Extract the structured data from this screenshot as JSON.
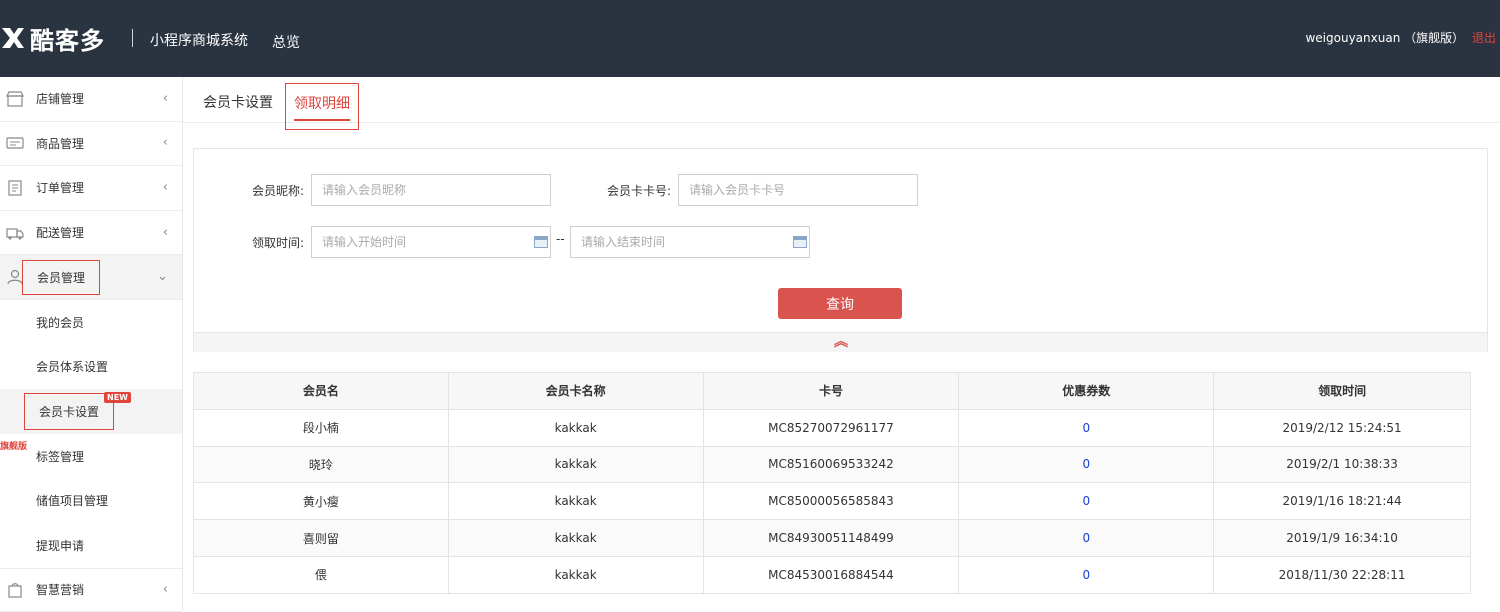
{
  "header": {
    "brand": "酷客多",
    "system_name": "小程序商城系统",
    "nav_overview": "总览",
    "username": "weigouyanxuan",
    "edition": "（旗舰版）",
    "logout": "退出"
  },
  "sidebar": {
    "items": [
      {
        "label": "店铺管理",
        "icon": "store-icon"
      },
      {
        "label": "商品管理",
        "icon": "goods-icon"
      },
      {
        "label": "订单管理",
        "icon": "order-icon"
      },
      {
        "label": "配送管理",
        "icon": "delivery-icon"
      },
      {
        "label": "会员管理",
        "icon": "member-icon"
      }
    ],
    "sub_items": [
      {
        "label": "我的会员"
      },
      {
        "label": "会员体系设置"
      },
      {
        "label": "会员卡设置"
      },
      {
        "label": "标签管理"
      },
      {
        "label": "储值项目管理"
      },
      {
        "label": "提现申请"
      }
    ],
    "bottom_item": {
      "label": "智慧营销",
      "icon": "marketing-icon"
    },
    "badge_new": "NEW",
    "badge_flag": "旗舰版"
  },
  "tabs": [
    {
      "label": "会员卡设置"
    },
    {
      "label": "领取明细",
      "active": true
    }
  ],
  "filter": {
    "nickname_label": "会员昵称:",
    "nickname_placeholder": "请输入会员昵称",
    "card_no_label": "会员卡卡号:",
    "card_no_placeholder": "请输入会员卡卡号",
    "time_label": "领取时间:",
    "start_placeholder": "请输入开始时间",
    "end_placeholder": "请输入结束时间",
    "range_sep": "--",
    "query_button": "查询",
    "collapse_icon": "double-chevron-up-icon"
  },
  "table": {
    "columns": [
      "会员名",
      "会员卡名称",
      "卡号",
      "优惠券数",
      "领取时间"
    ],
    "rows": [
      {
        "name": "段小楠",
        "card_name": "kakkak",
        "card_no": "MC85270072961177",
        "coupons": "0",
        "time": "2019/2/12 15:24:51"
      },
      {
        "name": "晓玲",
        "card_name": "kakkak",
        "card_no": "MC85160069533242",
        "coupons": "0",
        "time": "2019/2/1 10:38:33"
      },
      {
        "name": "黄小瘦",
        "card_name": "kakkak",
        "card_no": "MC85000056585843",
        "coupons": "0",
        "time": "2019/1/16 18:21:44"
      },
      {
        "name": "喜则留",
        "card_name": "kakkak",
        "card_no": "MC84930051148499",
        "coupons": "0",
        "time": "2019/1/9 16:34:10"
      },
      {
        "name": "偎",
        "card_name": "kakkak",
        "card_no": "MC84530016884544",
        "coupons": "0",
        "time": "2018/11/30 22:28:11"
      }
    ]
  },
  "colors": {
    "topbar_bg": "#2a3340",
    "accent_red": "#e0453c",
    "query_button": "#d9534f",
    "link_blue": "#1a3fd6"
  }
}
